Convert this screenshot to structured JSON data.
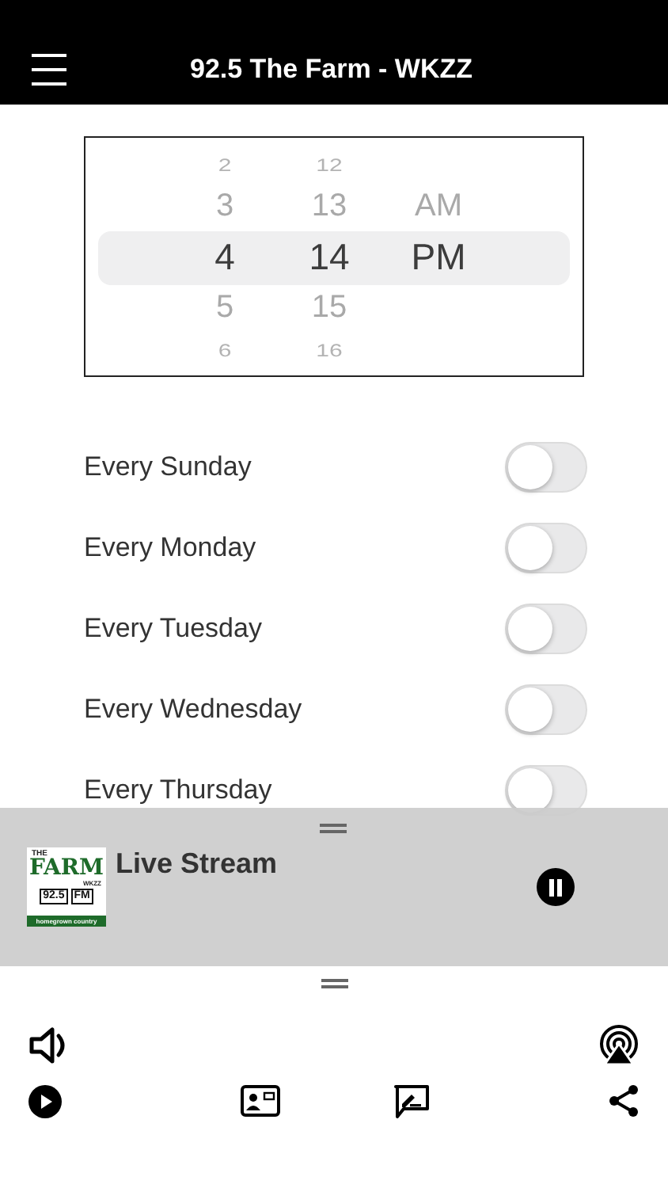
{
  "header": {
    "title": "92.5 The Farm - WKZZ"
  },
  "time_picker": {
    "columns": [
      {
        "kind": "hour",
        "items": [
          {
            "label": "2",
            "selected": false
          },
          {
            "label": "3",
            "selected": false
          },
          {
            "label": "4",
            "selected": true
          },
          {
            "label": "5",
            "selected": false
          },
          {
            "label": "6",
            "selected": false
          }
        ]
      },
      {
        "kind": "minute",
        "items": [
          {
            "label": "12",
            "selected": false
          },
          {
            "label": "13",
            "selected": false
          },
          {
            "label": "14",
            "selected": true
          },
          {
            "label": "15",
            "selected": false
          },
          {
            "label": "16",
            "selected": false
          }
        ]
      },
      {
        "kind": "period",
        "items": [
          {
            "label": "AM",
            "selected": false
          },
          {
            "label": "PM",
            "selected": true
          }
        ]
      }
    ]
  },
  "repeat_days": [
    {
      "label": "Every Sunday",
      "on": false
    },
    {
      "label": "Every Monday",
      "on": false
    },
    {
      "label": "Every Tuesday",
      "on": false
    },
    {
      "label": "Every Wednesday",
      "on": false
    },
    {
      "label": "Every Thursday",
      "on": false
    }
  ],
  "mini_player": {
    "title": "Live Stream",
    "playing": true,
    "logo": {
      "top": "THE",
      "name": "FARM",
      "call": "WKZZ",
      "frequency": "92.5",
      "band": "FM",
      "tagline": "homegrown country"
    }
  }
}
